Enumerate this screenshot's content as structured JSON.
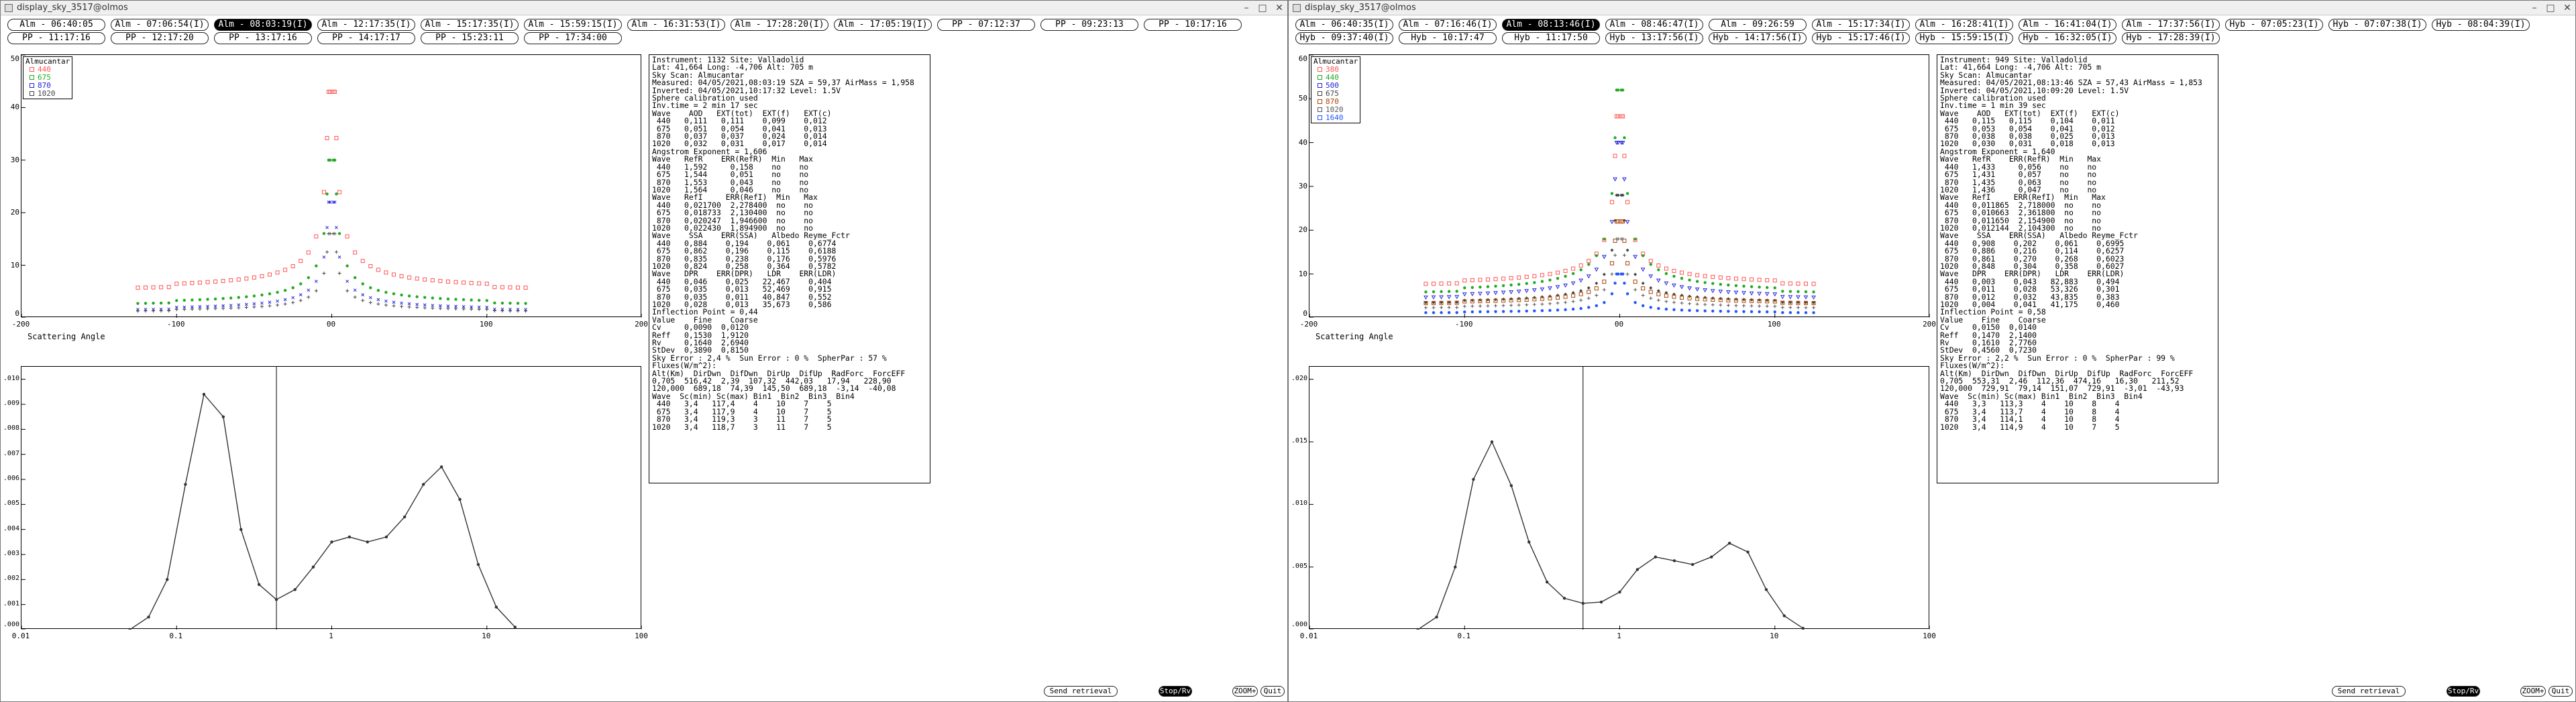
{
  "windows": [
    {
      "title": "display_sky_3517@olmos",
      "tabs_row1": [
        "Alm - 06:40:05",
        "Alm - 07:06:54(I)",
        "Alm - 08:03:19(I)",
        "Alm - 12:17:35(I)",
        "Alm - 15:17:35(I)",
        "Alm - 15:59:15(I)",
        "Alm - 16:31:53(I)",
        "Alm - 17:28:20(I)",
        "Alm - 17:05:19(I)",
        "PP - 07:12:37",
        "PP - 09:23:13",
        "PP - 10:17:16"
      ],
      "tabs_row2": [
        "PP - 11:17:16",
        "PP - 12:17:20",
        "PP - 13:17:16",
        "PP - 14:17:17",
        "PP - 15:23:11",
        "PP - 17:34:00"
      ],
      "selected_tab": 2,
      "legend_title": "Almucantar",
      "legend": [
        {
          "label": "440",
          "color": "#ff5555",
          "marker": "square"
        },
        {
          "label": "675",
          "color": "#22aa22",
          "marker": "circle"
        },
        {
          "label": "870",
          "color": "#2222dd",
          "marker": "x"
        },
        {
          "label": "1020",
          "color": "#444444",
          "marker": "plus"
        }
      ],
      "sky_chart": {
        "type": "scatter",
        "xlabel": "Scattering Angle",
        "xlim": [
          -200,
          200
        ],
        "ylim": [
          0,
          50
        ],
        "x_ticks": [
          "-200",
          "-100",
          "00",
          "100",
          "200"
        ],
        "y_ticks": [
          "0",
          "10",
          "20",
          "30",
          "40",
          "50"
        ],
        "peak": [
          43,
          30,
          22,
          16
        ],
        "floor": [
          5,
          2.2,
          1.2,
          1
        ]
      },
      "size_chart": {
        "type": "line",
        "x_ticks": [
          "0.01",
          "0.1",
          "1",
          "10",
          "100"
        ],
        "y_ticks": [
          ".000",
          ".001",
          ".002",
          ".003",
          ".004",
          ".005",
          ".006",
          ".007",
          ".008",
          ".009",
          ".010"
        ],
        "ylim": [
          0,
          0.0105
        ],
        "inflection": 0.44,
        "x": [
          0.05,
          0.066,
          0.087,
          0.114,
          0.15,
          0.2,
          0.26,
          0.34,
          0.44,
          0.58,
          0.76,
          1.0,
          1.3,
          1.7,
          2.25,
          2.95,
          3.9,
          5.1,
          6.7,
          8.8,
          11.5,
          15.2
        ],
        "y": [
          0,
          0.0005,
          0.002,
          0.0058,
          0.0094,
          0.0085,
          0.004,
          0.0018,
          0.0012,
          0.0016,
          0.0025,
          0.0035,
          0.0037,
          0.0035,
          0.0037,
          0.0045,
          0.0058,
          0.0065,
          0.0052,
          0.0026,
          0.0009,
          0.0001
        ]
      },
      "info": [
        "Instrument: 1132 Site: Valladolid",
        "Lat: 41,664 Long: -4,706 Alt: 705 m",
        "Sky Scan: Almucantar",
        "Measured: 04/05/2021,08:03:19 SZA = 59,37 AirMass = 1,958",
        "Inverted: 04/05/2021,10:17:32 Level: 1.5V",
        "Sphere calibration used",
        "Inv.time = 2 min 17 sec",
        "Wave    AOD   EXT(tot)  EXT(f)   EXT(c)",
        " 440   0,111   0,111    0,099    0,012",
        " 675   0,051   0,054    0,041    0,013",
        " 870   0,037   0,037    0,024    0,014",
        "1020   0,032   0,031    0,017    0,014",
        "Angstrom Exponent = 1,606",
        "Wave   RefR    ERR(RefR)  Min   Max",
        " 440   1,592     0,158    no    no",
        " 675   1,544     0,051    no    no",
        " 870   1,553     0,043    no    no",
        "1020   1,564     0,046    no    no",
        "Wave   RefI     ERR(RefI)  Min   Max",
        " 440   0,021700  2,278400  no    no",
        " 675   0,018733  2,130400  no    no",
        " 870   0,020247  1,946600  no    no",
        "1020   0,022430  1,894900  no    no",
        "Wave    SSA    ERR(SSA)   Albedo Reyme_Fctr",
        " 440   0,884    0,194    0,061    0,6774",
        " 675   0,862    0,196    0,115    0,6188",
        " 870   0,835    0,238    0,176    0,5976",
        "1020   0,824    0,258    0,364    0,5782",
        "Wave   DPR    ERR(DPR)   LDR    ERR(LDR)",
        " 440   0,046    0,025   22,467    0,404",
        " 675   0,035    0,013   52,469    0,915",
        " 870   0,035    0,011   40,847    0,552",
        "1020   0,028    0,013   35,673    0,586",
        "Inflection Point = 0,44",
        "Value    Fine    Coarse",
        "Cv     0,0090  0,0120",
        "Reff   0,1530  1,9120",
        "Rv     0,1640  2,6940",
        "StDev  0,3890  0,8150",
        "Sky Error : 2,4 %  Sun Error : 0 %  SpherPar : 57 %",
        "Fluxes(W/m^2):",
        "Alt(Km)  DirDwn  DifDwn  DirUp  DifUp  RadForc  ForcEFF",
        "0,705  516,42  2,39  107,32  442,03   17,94   228,90",
        "120,000  689,18  74,39  145,50  689,18  -3,14  -40,08",
        "Wave  Sc(min) Sc(max) Bin1  Bin2  Bin3  Bin4",
        " 440   3,4   117,4    4    10    7    5",
        " 675   3,4   117,9    4    10    7    5",
        " 870   3,4   119,3    3    11    7    5",
        "1020   3,4   118,7    3    11    7    5"
      ],
      "buttons": {
        "send": "Send retrieval",
        "status": "Stop/Rv",
        "zoom": "ZOOM+",
        "quit": "Quit"
      }
    },
    {
      "title": "display_sky_3517@olmos",
      "tabs_row1": [
        "Alm - 06:40:35(I)",
        "Alm - 07:16:46(I)",
        "Alm - 08:13:46(I)",
        "Alm - 08:46:47(I)",
        "Alm - 09:26:59",
        "Alm - 15:17:34(I)",
        "Alm - 16:28:41(I)",
        "Alm - 16:41:04(I)",
        "Alm - 17:37:56(I)",
        "Hyb - 07:05:23(I)",
        "Hyb - 07:07:38(I)",
        "Hyb - 08:04:39(I)"
      ],
      "tabs_row2": [
        "Hyb - 09:37:40(I)",
        "Hyb - 10:17:47",
        "Hyb - 11:17:50",
        "Hyb - 13:17:56(I)",
        "Hyb - 14:17:56(I)",
        "Hyb - 15:17:46(I)",
        "Hyb - 15:59:15(I)",
        "Hyb - 16:32:05(I)",
        "Hyb - 17:28:39(I)"
      ],
      "selected_tab": 2,
      "legend_title": "Almucantar",
      "legend": [
        {
          "label": "380",
          "color": "#ff5555",
          "marker": "square"
        },
        {
          "label": "440",
          "color": "#22aa22",
          "marker": "circle"
        },
        {
          "label": "500",
          "color": "#2222dd",
          "marker": "triangle"
        },
        {
          "label": "675",
          "color": "#444444",
          "marker": "diamond"
        },
        {
          "label": "870",
          "color": "#aa4400",
          "marker": "square"
        },
        {
          "label": "1020",
          "color": "#555555",
          "marker": "plus"
        },
        {
          "label": "1640",
          "color": "#2255ff",
          "marker": "circle"
        }
      ],
      "sky_chart": {
        "type": "scatter",
        "xlabel": "Scattering Angle",
        "xlim": [
          -200,
          200
        ],
        "ylim": [
          0,
          60
        ],
        "x_ticks": [
          "-200",
          "-100",
          "00",
          "100",
          "200"
        ],
        "y_ticks": [
          "0",
          "10",
          "20",
          "30",
          "40",
          "50",
          "60"
        ],
        "peak": [
          46,
          52,
          40,
          28,
          22,
          18,
          10
        ],
        "floor": [
          7,
          5,
          4,
          3,
          3,
          2,
          1
        ]
      },
      "size_chart": {
        "type": "line",
        "x_ticks": [
          "0.01",
          "0.1",
          "1",
          "10",
          "100"
        ],
        "y_ticks": [
          ".000",
          ".005",
          ".010",
          ".015",
          ".020"
        ],
        "ylim": [
          0,
          0.021
        ],
        "inflection": 0.58,
        "x": [
          0.05,
          0.066,
          0.087,
          0.114,
          0.15,
          0.2,
          0.26,
          0.34,
          0.44,
          0.58,
          0.76,
          1.0,
          1.3,
          1.7,
          2.25,
          2.95,
          3.9,
          5.1,
          6.7,
          8.8,
          11.5,
          15.2
        ],
        "y": [
          0,
          0.001,
          0.005,
          0.012,
          0.015,
          0.0115,
          0.007,
          0.0038,
          0.0025,
          0.0021,
          0.0022,
          0.003,
          0.0048,
          0.0058,
          0.0055,
          0.0052,
          0.0058,
          0.0069,
          0.0062,
          0.0032,
          0.0011,
          0.0001
        ]
      },
      "info": [
        "Instrument: 949 Site: Valladolid",
        "Lat: 41,664 Long: -4,706 Alt: 705 m",
        "Sky Scan: Almucantar",
        "Measured: 04/05/2021,08:13:46 SZA = 57,43 AirMass = 1,853",
        "Inverted: 04/05/2021,10:09:20 Level: 1.5V",
        "Sphere calibration used",
        "Inv.time = 1 min 39 sec",
        "Wave    AOD   EXT(tot)  EXT(f)   EXT(c)",
        " 440   0,115   0,115    0,104    0,011",
        " 675   0,053   0,054    0,041    0,012",
        " 870   0,038   0,038    0,025    0,013",
        "1020   0,030   0,031    0,018    0,013",
        "Angstrom Exponent = 1,640",
        "Wave   RefR    ERR(RefR)  Min   Max",
        " 440   1,433     0,056    no    no",
        " 675   1,431     0,057    no    no",
        " 870   1,435     0,063    no    no",
        "1020   1,436     0,047    no    no",
        "Wave   RefI     ERR(RefI)  Min   Max",
        " 440   0,011865  2,718000  no    no",
        " 675   0,010663  2,361800  no    no",
        " 870   0,011650  2,154900  no    no",
        "1020   0,012144  2,104300  no    no",
        "Wave    SSA    ERR(SSA)   Albedo Reyme_Fctr",
        " 440   0,908    0,202    0,061    0,6995",
        " 675   0,886    0,216    0,114    0,6257",
        " 870   0,861    0,270    0,268    0,6023",
        "1020   0,848    0,304    0,358    0,6027",
        "Wave   DPR    ERR(DPR)   LDR    ERR(LDR)",
        " 440   0,003    0,043   82,883    0,494",
        " 675   0,011    0,028   53,326    0,301",
        " 870   0,012    0,032   43,835    0,383",
        "1020   0,004    0,041   41,175    0,460",
        "Inflection Point = 0,58",
        "Value    Fine    Coarse",
        "Cv     0,0150  0,0140",
        "Reff   0,1470  2,1400",
        "Rv     0,1610  2,7760",
        "StDev  0,4560  0,7230",
        "Sky Error : 2,2 %  Sun Error : 0 %  SpherPar : 99 %",
        "Fluxes(W/m^2):",
        "Alt(Km)  DirDwn  DifDwn  DirUp  DifUp  RadForc  ForcEFF",
        "0,705  553,31  2,46  112,36  474,16   16,30   211,52",
        "120,000  729,91  79,14  151,07  729,91  -3,01  -43,93",
        "Wave  Sc(min) Sc(max) Bin1  Bin2  Bin3  Bin4",
        " 440   3,3   113,3    4    10    8    4",
        " 675   3,4   113,7    4    10    8    4",
        " 870   3,4   114,1    4    10    8    4",
        "1020   3,4   114,9    4    10    7    5"
      ],
      "buttons": {
        "send": "Send retrieval",
        "status": "Stop/Rv",
        "zoom": "ZOOM+",
        "quit": "Quit"
      }
    }
  ]
}
